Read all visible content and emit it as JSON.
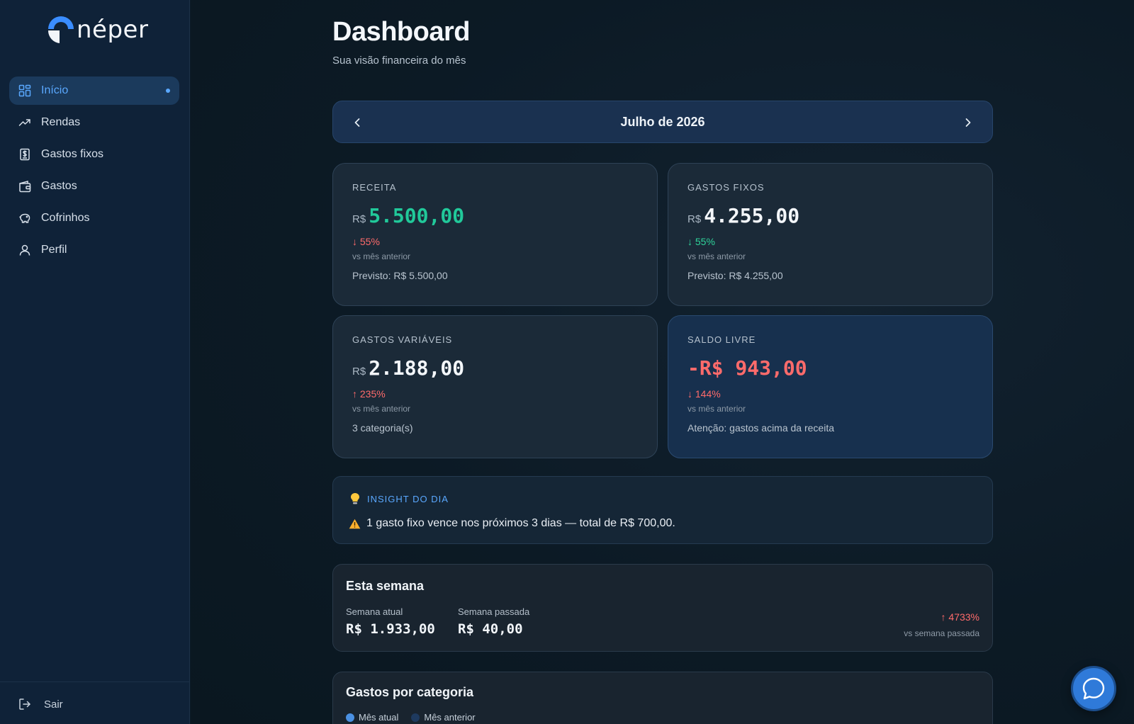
{
  "app": {
    "logo_text": "néper"
  },
  "sidebar": {
    "items": [
      {
        "label": "Início",
        "icon": "dashboard-icon",
        "active": true
      },
      {
        "label": "Rendas",
        "icon": "trending-up-icon"
      },
      {
        "label": "Gastos fixos",
        "icon": "receipt-icon"
      },
      {
        "label": "Gastos",
        "icon": "wallet-icon"
      },
      {
        "label": "Cofrinhos",
        "icon": "piggy-bank-icon"
      },
      {
        "label": "Perfil",
        "icon": "user-icon"
      }
    ],
    "logout_label": "Sair"
  },
  "header": {
    "title": "Dashboard",
    "subtitle": "Sua visão financeira do mês"
  },
  "month_nav": {
    "label": "Julho de 2026"
  },
  "cards": {
    "receita": {
      "label": "RECEITA",
      "currency": "R$",
      "value": "5.500,00",
      "delta": "↓ 55%",
      "delta_sub": "vs mês anterior",
      "foot": "Previsto: R$ 5.500,00"
    },
    "gastos_fixos": {
      "label": "GASTOS FIXOS",
      "currency": "R$",
      "value": "4.255,00",
      "delta": "↓ 55%",
      "delta_sub": "vs mês anterior",
      "foot": "Previsto: R$ 4.255,00"
    },
    "gastos_variaveis": {
      "label": "GASTOS VARIÁVEIS",
      "currency": "R$",
      "value": "2.188,00",
      "delta": "↑ 235%",
      "delta_sub": "vs mês anterior",
      "foot": "3 categoria(s)"
    },
    "saldo_livre": {
      "label": "SALDO LIVRE",
      "value": "-R$ 943,00",
      "delta": "↓ 144%",
      "delta_sub": "vs mês anterior",
      "foot": "Atenção: gastos acima da receita"
    }
  },
  "insight": {
    "title": "INSIGHT DO DIA",
    "text": "1 gasto fixo vence nos próximos 3 dias — total de R$ 700,00."
  },
  "week": {
    "title": "Esta semana",
    "current_label": "Semana atual",
    "current_value": "R$ 1.933,00",
    "previous_label": "Semana passada",
    "previous_value": "R$ 40,00",
    "delta": "↑ 4733%",
    "delta_sub": "vs semana passada"
  },
  "category": {
    "title": "Gastos por categoria",
    "legend": [
      {
        "label": "Mês atual",
        "color": "#4a90e2"
      },
      {
        "label": "Mês anterior",
        "color": "#1e3a5f"
      }
    ]
  },
  "colors": {
    "accent": "#5aa8ff",
    "positive": "#21c99a",
    "negative": "#ff6b6b",
    "chat_button": "#2f7ad9"
  }
}
